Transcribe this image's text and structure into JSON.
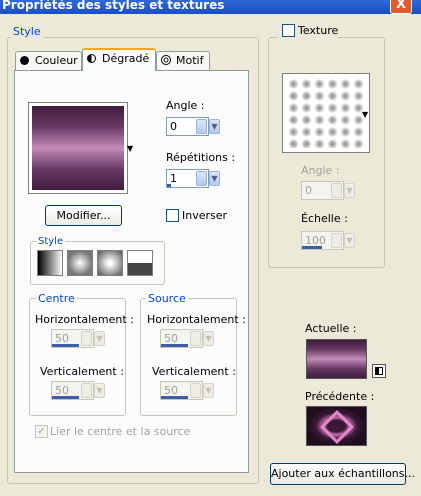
{
  "window": {
    "title": "Propriétés des styles et textures",
    "close": "X"
  },
  "style_group": {
    "label": "Style"
  },
  "tabs": [
    {
      "label": "Couleur",
      "icon": "color-circle-icon"
    },
    {
      "label": "Dégradé",
      "icon": "gradient-half-circle-icon",
      "active": true
    },
    {
      "label": "Motif",
      "icon": "pattern-icon"
    }
  ],
  "gradient": {
    "angle_label": "Angle :",
    "angle_value": "0",
    "repetitions_label": "Répétitions :",
    "repetitions_value": "1",
    "modify_button": "Modifier...",
    "invert_label": "Inverser",
    "invert_checked": false,
    "style_label": "Style",
    "style_buttons": [
      "linear-style",
      "rectangular-style",
      "radial-style",
      "sunburst-style"
    ]
  },
  "centre": {
    "label": "Centre",
    "horizontal_label": "Horizontalement :",
    "horizontal_value": "50",
    "vertical_label": "Verticalement :",
    "vertical_value": "50"
  },
  "source": {
    "label": "Source",
    "horizontal_label": "Horizontalement :",
    "horizontal_value": "50",
    "vertical_label": "Verticalement :",
    "vertical_value": "50"
  },
  "link_label": "Lier le centre et la source",
  "link_checked": true,
  "texture": {
    "label": "Texture",
    "checked": false,
    "angle_label": "Angle :",
    "angle_value": "0",
    "scale_label": "Échelle :",
    "scale_value": "100"
  },
  "preview": {
    "current_label": "Actuelle :",
    "previous_label": "Précédente :"
  },
  "add_button": "Ajouter aux échantillons...",
  "colors": {
    "gradient_dark": "#4a2448",
    "gradient_light": "#c48bb8",
    "accent": "#0046d5"
  }
}
